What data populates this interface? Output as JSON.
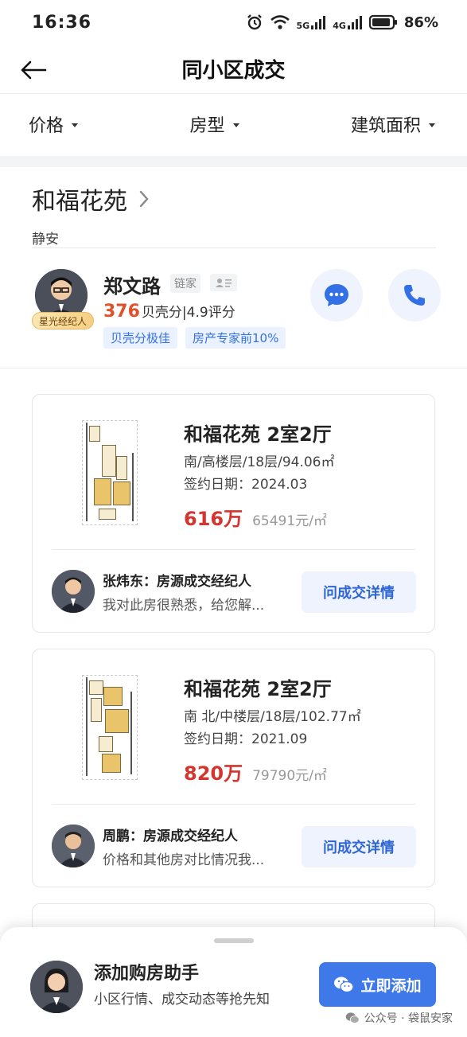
{
  "status_bar": {
    "time": "16:36",
    "net_a": "5G",
    "net_b": "4G",
    "battery": "86%"
  },
  "nav": {
    "title": "同小区成交"
  },
  "filters": [
    {
      "label": "价格"
    },
    {
      "label": "房型"
    },
    {
      "label": "建筑面积"
    }
  ],
  "community": {
    "name": "和福花苑",
    "district": "静安"
  },
  "agent": {
    "name": "郑文路",
    "company": "链家",
    "badge": "星光经纪人",
    "score_value": "376",
    "score_text": "贝壳分|4.9评分",
    "tags": [
      "贝壳分极佳",
      "房产专家前10%"
    ]
  },
  "listings": [
    {
      "title": "和福花苑 2室2厅",
      "meta": "南/高楼层/18层/94.06㎡",
      "date": "签约日期：2024.03",
      "price": "616万",
      "unit_price": "65491元/㎡",
      "agent_title": "张炜东：房源成交经纪人",
      "agent_desc": "我对此房很熟悉，给您解...",
      "button": "问成交详情"
    },
    {
      "title": "和福花苑 2室2厅",
      "meta": "南 北/中楼层/18层/102.77㎡",
      "date": "签约日期：2021.09",
      "price": "820万",
      "unit_price": "79790元/㎡",
      "agent_title": "周鹏：房源成交经纪人",
      "agent_desc": "价格和其他房对比情况我...",
      "button": "问成交详情"
    }
  ],
  "assistant": {
    "title": "添加购房助手",
    "subtitle": "小区行情、成交动态等抢先知",
    "button": "立即添加"
  },
  "watermark": "公众号 · 袋鼠安家",
  "colors": {
    "price_red": "#d4352e",
    "score_orange": "#e0502a",
    "primary_blue": "#3f78e8",
    "tag_blue": "#3470e4"
  }
}
